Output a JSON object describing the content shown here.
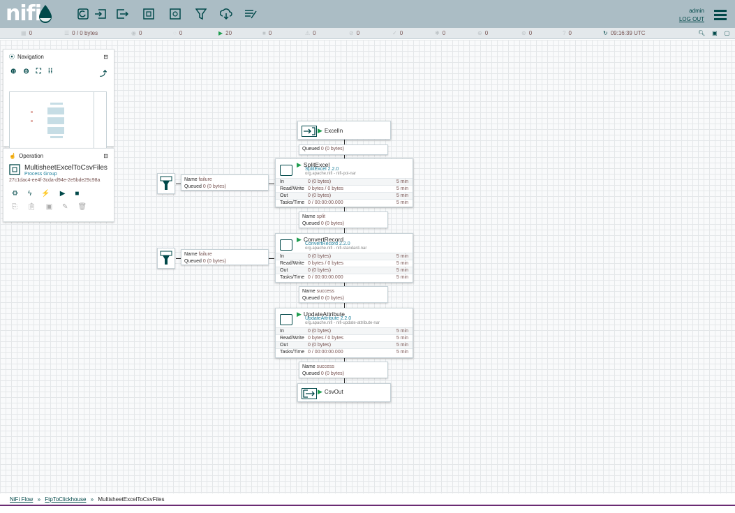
{
  "header": {
    "logo_text": "nifi",
    "user": "admin",
    "logout": "LOG OUT"
  },
  "status": {
    "active_threads": "0",
    "queued": "0 / 0 bytes",
    "transmitting": "0",
    "not_transmitting": "0",
    "running": "20",
    "stopped": "0",
    "invalid": "0",
    "disabled": "0",
    "up_to_date": "0",
    "locally_modified": "0",
    "stale": "0",
    "locally_modified_stale": "0",
    "sync_failure": "0",
    "time": "09:16:39 UTC"
  },
  "navigation": {
    "title": "Navigation"
  },
  "operation": {
    "title": "Operation",
    "name": "MultisheetExcelToCsvFiles",
    "type": "Process Group",
    "id": "27c1dac4-ee4f-3cda-d94e-2e5bde29c98a"
  },
  "input_port": {
    "name": "ExcelIn"
  },
  "output_port": {
    "name": "CsvOut"
  },
  "processors": [
    {
      "name": "SplitExcel",
      "type": "SplitExcel 2.2.0",
      "bundle": "org.apache.nifi - nifi-poi-nar",
      "in": "0 (0 bytes)",
      "rw": "0 bytes / 0 bytes",
      "out": "0 (0 bytes)",
      "tasks": "0 / 00:00:00.000",
      "window": "5 min"
    },
    {
      "name": "ConvertRecord",
      "type": "ConvertRecord 2.2.0",
      "bundle": "org.apache.nifi - nifi-standard-nar",
      "in": "0 (0 bytes)",
      "rw": "0 bytes / 0 bytes",
      "out": "0 (0 bytes)",
      "tasks": "0 / 00:00:00.000",
      "window": "5 min"
    },
    {
      "name": "UpdateAttribute",
      "type": "UpdateAttribute 2.2.0",
      "bundle": "org.apache.nifi - nifi-update-attribute-nar",
      "in": "0 (0 bytes)",
      "rw": "0 bytes / 0 bytes",
      "out": "0 (0 bytes)",
      "tasks": "0 / 00:00:00.000",
      "window": "5 min"
    }
  ],
  "stat_labels": {
    "in": "In",
    "rw": "Read/Write",
    "out": "Out",
    "tasks": "Tasks/Time"
  },
  "connections": {
    "c1": {
      "queued_label": "Queued",
      "queued": "0 (0 bytes)"
    },
    "c2": {
      "name_label": "Name",
      "name": "split",
      "queued_label": "Queued",
      "queued": "0 (0 bytes)"
    },
    "c3": {
      "name_label": "Name",
      "name": "success",
      "queued_label": "Queued",
      "queued": "0 (0 bytes)"
    },
    "c4": {
      "name_label": "Name",
      "name": "success",
      "queued_label": "Queued",
      "queued": "0 (0 bytes)"
    },
    "f1": {
      "name_label": "Name",
      "name": "failure",
      "queued_label": "Queued",
      "queued": "0 (0 bytes)"
    },
    "f2": {
      "name_label": "Name",
      "name": "failure",
      "queued_label": "Queued",
      "queued": "0 (0 bytes)"
    }
  },
  "breadcrumbs": {
    "root": "NiFi Flow",
    "sep": "»",
    "parent": "FtpToClickhouse",
    "current": "MultisheetExcelToCsvFiles"
  }
}
